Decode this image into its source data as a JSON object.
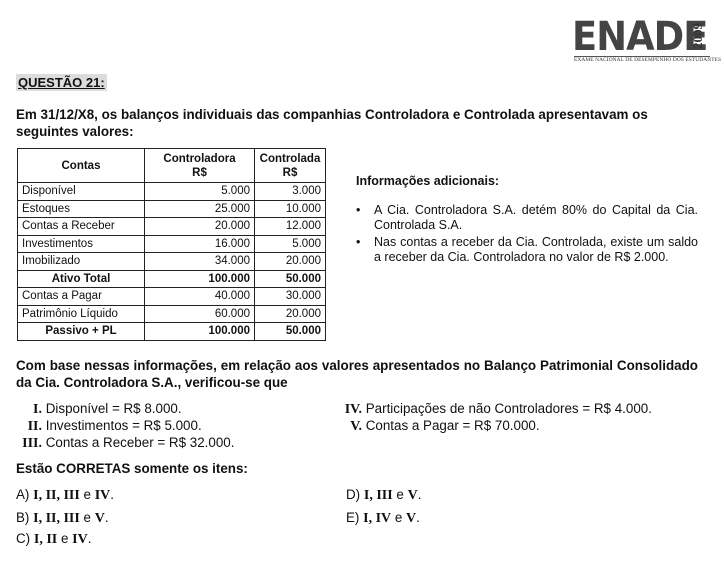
{
  "logo": {
    "word": "ENADE",
    "year": "2009",
    "subtitle": "EXAME NACIONAL DE DESEMPENHO DOS ESTUDANTES"
  },
  "question": {
    "label": "QUESTÃO 21:",
    "stem": "Em 31/12/X8, os balanços individuais das companhias Controladora e Controlada apresentavam os seguintes valores:"
  },
  "table": {
    "headers": [
      "Contas",
      "Controladora\nR$",
      "Controlada\nR$"
    ],
    "rows": [
      {
        "label": "Disponível",
        "controladora": "5.000",
        "controlada": "3.000",
        "total": false
      },
      {
        "label": "Estoques",
        "controladora": "25.000",
        "controlada": "10.000",
        "total": false
      },
      {
        "label": "Contas a Receber",
        "controladora": "20.000",
        "controlada": "12.000",
        "total": false
      },
      {
        "label": "Investimentos",
        "controladora": "16.000",
        "controlada": "5.000",
        "total": false
      },
      {
        "label": "Imobilizado",
        "controladora": "34.000",
        "controlada": "20.000",
        "total": false
      },
      {
        "label": "Ativo Total",
        "controladora": "100.000",
        "controlada": "50.000",
        "total": true
      },
      {
        "label": "Contas a Pagar",
        "controladora": "40.000",
        "controlada": "30.000",
        "total": false
      },
      {
        "label": "Patrimônio Líquido",
        "controladora": "60.000",
        "controlada": "20.000",
        "total": false
      },
      {
        "label": "Passivo + PL",
        "controladora": "100.000",
        "controlada": "50.000",
        "total": true
      }
    ]
  },
  "info": {
    "title": "Informações adicionais:",
    "bullet": "•",
    "items": [
      "A Cia. Controladora S.A. detém 80% do Capital da Cia. Controlada S.A.",
      "Nas contas a receber da Cia. Controlada, existe um saldo a receber da Cia. Controladora no valor de R$ 2.000."
    ]
  },
  "prompt": "Com base nessas informações, em relação aos valores apresentados no Balanço Patrimonial Consolidado da Cia. Controladora S.A., verificou-se que",
  "statements": [
    {
      "numeral": "I.",
      "text": "Disponível = R$ 8.000."
    },
    {
      "numeral": "II.",
      "text": "Investimentos = R$ 5.000."
    },
    {
      "numeral": "III.",
      "text": "Contas a Receber = R$ 32.000."
    },
    {
      "numeral": "IV.",
      "text": "Participações de não Controladores = R$ 4.000."
    },
    {
      "numeral": "V.",
      "text": "Contas a Pagar = R$ 70.000."
    }
  ],
  "corretas": "Estão CORRETAS somente os itens:",
  "options": [
    {
      "letter": "A)",
      "parts": [
        "I, II, III",
        " e ",
        "IV",
        "."
      ]
    },
    {
      "letter": "B)",
      "parts": [
        "I, II, III",
        " e ",
        "V",
        "."
      ]
    },
    {
      "letter": "C)",
      "parts": [
        "I, II",
        " e ",
        "IV",
        "."
      ]
    },
    {
      "letter": "D)",
      "parts": [
        "I, III",
        " e ",
        "V",
        "."
      ]
    },
    {
      "letter": "E)",
      "parts": [
        "I, IV",
        " e ",
        "V",
        "."
      ]
    }
  ]
}
